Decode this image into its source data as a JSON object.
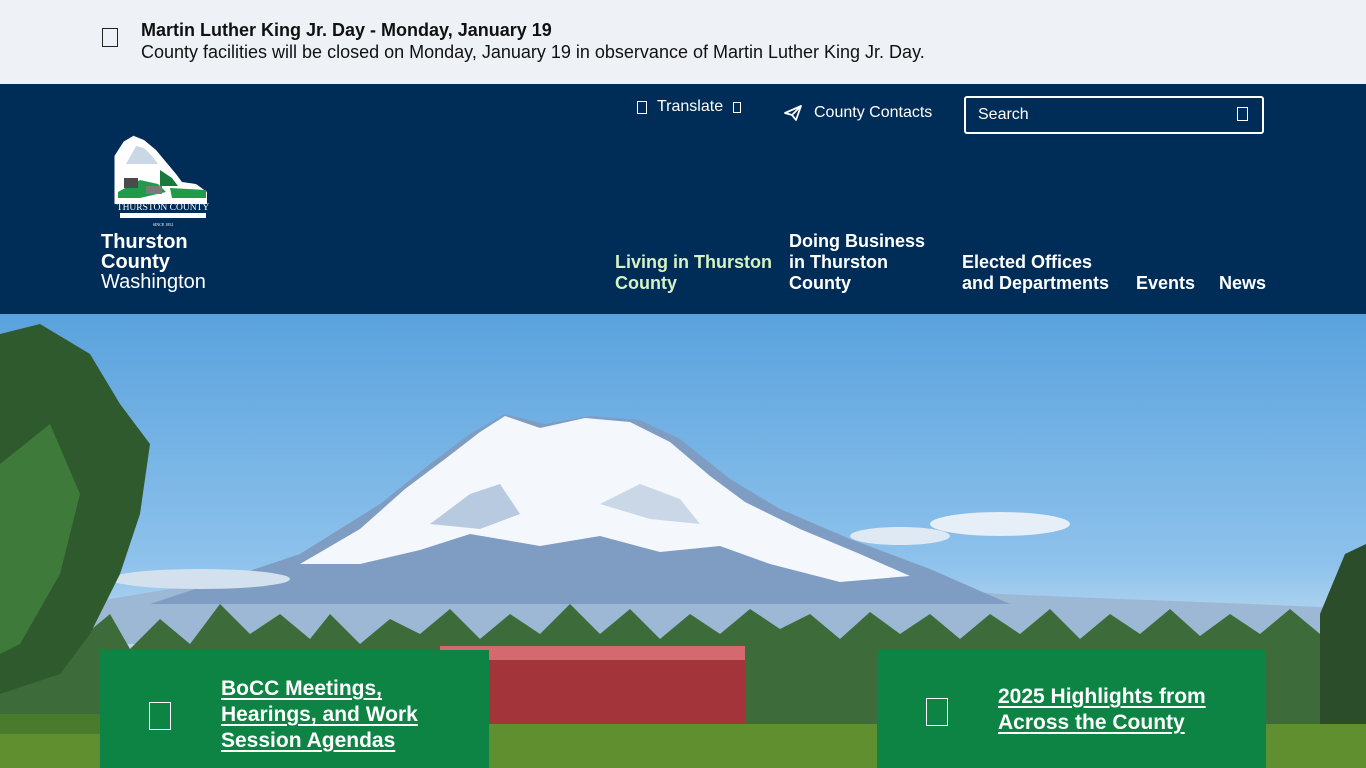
{
  "alert": {
    "title": "Martin Luther King Jr. Day - Monday, January 19",
    "body": "County facilities will be closed on Monday, January 19 in observance of Martin Luther King Jr. Day."
  },
  "header": {
    "logo": {
      "emblem_text": "THURSTON COUNTY",
      "since": "SINCE 1852",
      "line1": "Thurston",
      "line2": "County",
      "line3": "Washington"
    },
    "utility": {
      "translate_label": "Translate",
      "contacts_label": "County Contacts",
      "search_placeholder": "Search"
    },
    "nav": {
      "living": "Living in Thurston County",
      "business": "Doing Business in Thurston County",
      "elected": "Elected Offices and Departments",
      "events": "Events",
      "news": "News"
    }
  },
  "hero": {
    "cards": {
      "left": "BoCC Meetings, Hearings, and Work Session Agendas",
      "right": "2025 Highlights from Across the County"
    }
  },
  "colors": {
    "header_bg": "#002d57",
    "alert_bg": "#eef2f7",
    "card_green": "#0d8444",
    "nav_active": "#d6f2c3"
  }
}
